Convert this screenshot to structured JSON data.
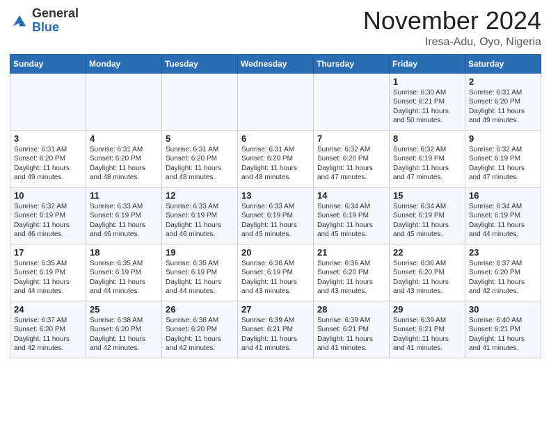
{
  "header": {
    "logo": {
      "general": "General",
      "blue": "Blue"
    },
    "month": "November 2024",
    "location": "Iresa-Adu, Oyo, Nigeria"
  },
  "weekdays": [
    "Sunday",
    "Monday",
    "Tuesday",
    "Wednesday",
    "Thursday",
    "Friday",
    "Saturday"
  ],
  "weeks": [
    [
      {
        "day": "",
        "info": ""
      },
      {
        "day": "",
        "info": ""
      },
      {
        "day": "",
        "info": ""
      },
      {
        "day": "",
        "info": ""
      },
      {
        "day": "",
        "info": ""
      },
      {
        "day": "1",
        "info": "Sunrise: 6:30 AM\nSunset: 6:21 PM\nDaylight: 11 hours\nand 50 minutes."
      },
      {
        "day": "2",
        "info": "Sunrise: 6:31 AM\nSunset: 6:20 PM\nDaylight: 11 hours\nand 49 minutes."
      }
    ],
    [
      {
        "day": "3",
        "info": "Sunrise: 6:31 AM\nSunset: 6:20 PM\nDaylight: 11 hours\nand 49 minutes."
      },
      {
        "day": "4",
        "info": "Sunrise: 6:31 AM\nSunset: 6:20 PM\nDaylight: 11 hours\nand 48 minutes."
      },
      {
        "day": "5",
        "info": "Sunrise: 6:31 AM\nSunset: 6:20 PM\nDaylight: 11 hours\nand 48 minutes."
      },
      {
        "day": "6",
        "info": "Sunrise: 6:31 AM\nSunset: 6:20 PM\nDaylight: 11 hours\nand 48 minutes."
      },
      {
        "day": "7",
        "info": "Sunrise: 6:32 AM\nSunset: 6:20 PM\nDaylight: 11 hours\nand 47 minutes."
      },
      {
        "day": "8",
        "info": "Sunrise: 6:32 AM\nSunset: 6:19 PM\nDaylight: 11 hours\nand 47 minutes."
      },
      {
        "day": "9",
        "info": "Sunrise: 6:32 AM\nSunset: 6:19 PM\nDaylight: 11 hours\nand 47 minutes."
      }
    ],
    [
      {
        "day": "10",
        "info": "Sunrise: 6:32 AM\nSunset: 6:19 PM\nDaylight: 11 hours\nand 46 minutes."
      },
      {
        "day": "11",
        "info": "Sunrise: 6:33 AM\nSunset: 6:19 PM\nDaylight: 11 hours\nand 46 minutes."
      },
      {
        "day": "12",
        "info": "Sunrise: 6:33 AM\nSunset: 6:19 PM\nDaylight: 11 hours\nand 46 minutes."
      },
      {
        "day": "13",
        "info": "Sunrise: 6:33 AM\nSunset: 6:19 PM\nDaylight: 11 hours\nand 45 minutes."
      },
      {
        "day": "14",
        "info": "Sunrise: 6:34 AM\nSunset: 6:19 PM\nDaylight: 11 hours\nand 45 minutes."
      },
      {
        "day": "15",
        "info": "Sunrise: 6:34 AM\nSunset: 6:19 PM\nDaylight: 11 hours\nand 45 minutes."
      },
      {
        "day": "16",
        "info": "Sunrise: 6:34 AM\nSunset: 6:19 PM\nDaylight: 11 hours\nand 44 minutes."
      }
    ],
    [
      {
        "day": "17",
        "info": "Sunrise: 6:35 AM\nSunset: 6:19 PM\nDaylight: 11 hours\nand 44 minutes."
      },
      {
        "day": "18",
        "info": "Sunrise: 6:35 AM\nSunset: 6:19 PM\nDaylight: 11 hours\nand 44 minutes."
      },
      {
        "day": "19",
        "info": "Sunrise: 6:35 AM\nSunset: 6:19 PM\nDaylight: 11 hours\nand 44 minutes."
      },
      {
        "day": "20",
        "info": "Sunrise: 6:36 AM\nSunset: 6:19 PM\nDaylight: 11 hours\nand 43 minutes."
      },
      {
        "day": "21",
        "info": "Sunrise: 6:36 AM\nSunset: 6:20 PM\nDaylight: 11 hours\nand 43 minutes."
      },
      {
        "day": "22",
        "info": "Sunrise: 6:36 AM\nSunset: 6:20 PM\nDaylight: 11 hours\nand 43 minutes."
      },
      {
        "day": "23",
        "info": "Sunrise: 6:37 AM\nSunset: 6:20 PM\nDaylight: 11 hours\nand 42 minutes."
      }
    ],
    [
      {
        "day": "24",
        "info": "Sunrise: 6:37 AM\nSunset: 6:20 PM\nDaylight: 11 hours\nand 42 minutes."
      },
      {
        "day": "25",
        "info": "Sunrise: 6:38 AM\nSunset: 6:20 PM\nDaylight: 11 hours\nand 42 minutes."
      },
      {
        "day": "26",
        "info": "Sunrise: 6:38 AM\nSunset: 6:20 PM\nDaylight: 11 hours\nand 42 minutes."
      },
      {
        "day": "27",
        "info": "Sunrise: 6:39 AM\nSunset: 6:21 PM\nDaylight: 11 hours\nand 41 minutes."
      },
      {
        "day": "28",
        "info": "Sunrise: 6:39 AM\nSunset: 6:21 PM\nDaylight: 11 hours\nand 41 minutes."
      },
      {
        "day": "29",
        "info": "Sunrise: 6:39 AM\nSunset: 6:21 PM\nDaylight: 11 hours\nand 41 minutes."
      },
      {
        "day": "30",
        "info": "Sunrise: 6:40 AM\nSunset: 6:21 PM\nDaylight: 11 hours\nand 41 minutes."
      }
    ]
  ]
}
